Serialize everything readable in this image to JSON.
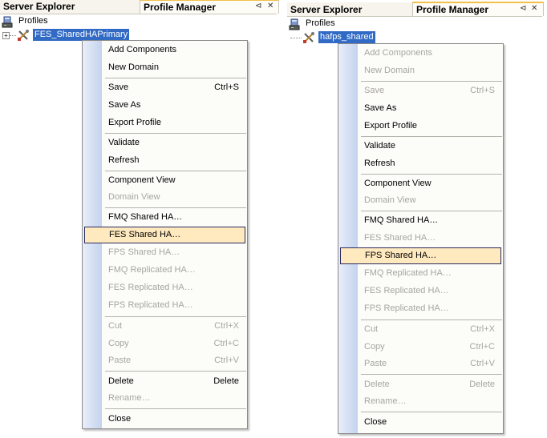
{
  "left": {
    "tabs": {
      "server_explorer": "Server Explorer",
      "profile_manager": "Profile Manager",
      "pin": "⊲",
      "close": "✕"
    },
    "tree": {
      "root": "Profiles",
      "profile": "FES_SharedHAPrimary",
      "expander": "+"
    },
    "menu": {
      "add_components": "Add Components",
      "new_domain": "New Domain",
      "save": "Save",
      "save_sc": "Ctrl+S",
      "save_as": "Save As",
      "export_profile": "Export Profile",
      "validate": "Validate",
      "refresh": "Refresh",
      "component_view": "Component View",
      "domain_view": "Domain View",
      "fmq_shared": "FMQ Shared HA…",
      "fes_shared": "FES Shared HA…",
      "fps_shared": "FPS Shared HA…",
      "fmq_replicated": "FMQ Replicated HA…",
      "fes_replicated": "FES Replicated HA…",
      "fps_replicated": "FPS Replicated HA…",
      "cut": "Cut",
      "cut_sc": "Ctrl+X",
      "copy": "Copy",
      "copy_sc": "Ctrl+C",
      "paste": "Paste",
      "paste_sc": "Ctrl+V",
      "delete": "Delete",
      "delete_sc": "Delete",
      "rename": "Rename…",
      "close": "Close"
    }
  },
  "right": {
    "tabs": {
      "server_explorer": "Server Explorer",
      "profile_manager": "Profile Manager",
      "pin": "⊲",
      "close": "✕"
    },
    "tree": {
      "root": "Profiles",
      "profile": "hafps_shared",
      "expander": "+"
    },
    "menu": {
      "add_components": "Add Components",
      "new_domain": "New Domain",
      "save": "Save",
      "save_sc": "Ctrl+S",
      "save_as": "Save As",
      "export_profile": "Export Profile",
      "validate": "Validate",
      "refresh": "Refresh",
      "component_view": "Component View",
      "domain_view": "Domain View",
      "fmq_shared": "FMQ Shared HA…",
      "fes_shared": "FES Shared HA…",
      "fps_shared": "FPS Shared HA…",
      "fmq_replicated": "FMQ Replicated HA…",
      "fes_replicated": "FES Replicated HA…",
      "fps_replicated": "FPS Replicated HA…",
      "cut": "Cut",
      "cut_sc": "Ctrl+X",
      "copy": "Copy",
      "copy_sc": "Ctrl+C",
      "paste": "Paste",
      "paste_sc": "Ctrl+V",
      "delete": "Delete",
      "delete_sc": "Delete",
      "rename": "Rename…",
      "close": "Close"
    }
  },
  "colors": {
    "selection": "#316ac5",
    "highlight": "#ffe9bf",
    "disabled_text": "#a7a69f",
    "tab_accent": "#f3c04a"
  },
  "icons": {
    "profiles": "database-icon",
    "profile": "tools-icon"
  }
}
